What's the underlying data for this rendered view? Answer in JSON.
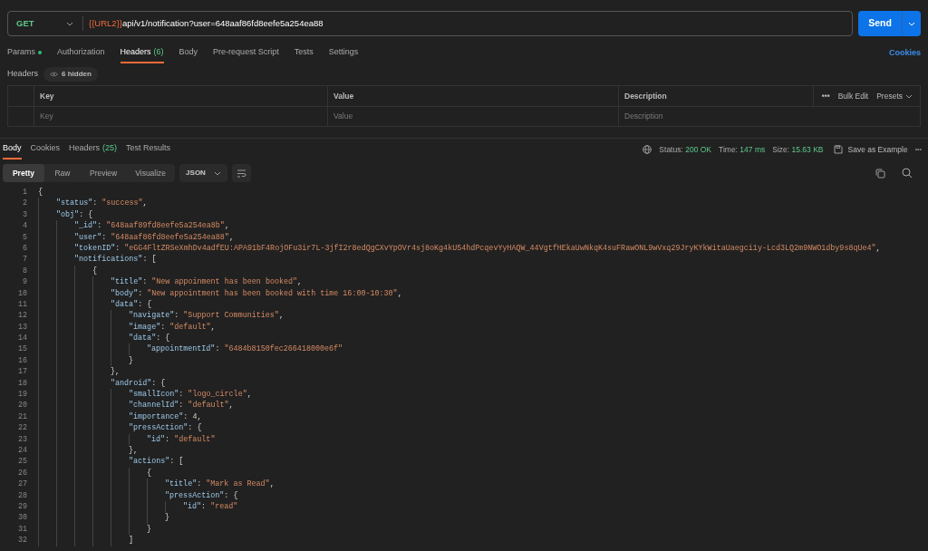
{
  "request": {
    "method": "GET",
    "url_variable": "{{URL2}}",
    "url_path": "api/v1/notification?user=648aaf86fd8eefe5a254ea88",
    "send": "Send"
  },
  "request_tabs": [
    {
      "label": "Params",
      "has_values": true,
      "selected": false
    },
    {
      "label": "Authorization",
      "selected": false
    },
    {
      "label": "Headers",
      "count": "(6)",
      "selected": true
    },
    {
      "label": "Body",
      "selected": false
    },
    {
      "label": "Pre-request Script",
      "selected": false
    },
    {
      "label": "Tests",
      "selected": false
    },
    {
      "label": "Settings",
      "selected": false
    }
  ],
  "cookies_link": "Cookies",
  "headers": {
    "title": "Headers",
    "hidden": "6 hidden",
    "columns": [
      "Key",
      "Value",
      "Description"
    ],
    "more": "•••",
    "bulk_edit": "Bulk Edit",
    "presets": "Presets",
    "placeholders": [
      "Key",
      "Value",
      "Description"
    ]
  },
  "response_tabs": [
    {
      "label": "Body",
      "selected": true
    },
    {
      "label": "Cookies",
      "selected": false
    },
    {
      "label": "Headers",
      "count": "(25)",
      "selected": false
    },
    {
      "label": "Test Results",
      "selected": false
    }
  ],
  "response_status": {
    "status_label": "Status:",
    "status": "200 OK",
    "time_label": "Time:",
    "time": "147 ms",
    "size_label": "Size:",
    "size": "15.63 KB",
    "save": "Save as Example",
    "more": "•••"
  },
  "view_modes": [
    {
      "label": "Pretty",
      "selected": true
    },
    {
      "label": "Raw",
      "selected": false
    },
    {
      "label": "Preview",
      "selected": false
    },
    {
      "label": "Visualize",
      "selected": false
    }
  ],
  "format": "JSON",
  "code_lines": [
    {
      "number": "1",
      "tokens": [
        {
          "kind": "punct",
          "text": "{"
        }
      ],
      "children": [
        {
          "number": "2",
          "tokens": [
            {
              "kind": "key",
              "text": "\"status\""
            },
            {
              "kind": "punct",
              "text": ": "
            },
            {
              "kind": "string",
              "text": "\"success\""
            },
            {
              "kind": "punct",
              "text": ","
            }
          ]
        },
        {
          "number": "3",
          "tokens": [
            {
              "kind": "key",
              "text": "\"obj\""
            },
            {
              "kind": "punct",
              "text": ": {"
            }
          ],
          "children": [
            {
              "number": "4",
              "tokens": [
                {
                  "kind": "key",
                  "text": "\"_id\""
                },
                {
                  "kind": "punct",
                  "text": ": "
                },
                {
                  "kind": "string",
                  "text": "\"648aaf89fd8eefe5a254ea8b\""
                },
                {
                  "kind": "punct",
                  "text": ","
                }
              ]
            },
            {
              "number": "5",
              "tokens": [
                {
                  "kind": "key",
                  "text": "\"user\""
                },
                {
                  "kind": "punct",
                  "text": ": "
                },
                {
                  "kind": "string",
                  "text": "\"648aaf86fd8eefe5a254ea88\""
                },
                {
                  "kind": "punct",
                  "text": ","
                }
              ]
            },
            {
              "number": "6",
              "tokens": [
                {
                  "kind": "key",
                  "text": "\"tokenID\""
                },
                {
                  "kind": "punct",
                  "text": ": "
                },
                {
                  "kind": "string",
                  "text": "\"eGG4FltZRSeXmhDv4adfEU:APA91bF4RojOFu3ir7L-3jfI2r8edQgCXvYpOVr4sj8oKg4kU54hdPcqevYyHAQW_44VgtfHEkaUwNkqK4suFRawONL9wVxq29JryKYkWitaUaegci1y-Lcd3LQ2m9NWO1dby9s8qUe4\""
                },
                {
                  "kind": "punct",
                  "text": ","
                }
              ]
            },
            {
              "number": "7",
              "tokens": [
                {
                  "kind": "key",
                  "text": "\"notifications\""
                },
                {
                  "kind": "punct",
                  "text": ": ["
                }
              ],
              "children": [
                {
                  "number": "8",
                  "tokens": [
                    {
                      "kind": "punct",
                      "text": "{"
                    }
                  ],
                  "children": [
                    {
                      "number": "9",
                      "tokens": [
                        {
                          "kind": "key",
                          "text": "\"title\""
                        },
                        {
                          "kind": "punct",
                          "text": ": "
                        },
                        {
                          "kind": "string",
                          "text": "\"New appoinment has been booked\""
                        },
                        {
                          "kind": "punct",
                          "text": ","
                        }
                      ]
                    },
                    {
                      "number": "10",
                      "tokens": [
                        {
                          "kind": "key",
                          "text": "\"body\""
                        },
                        {
                          "kind": "punct",
                          "text": ": "
                        },
                        {
                          "kind": "string",
                          "text": "\"New appointment has been booked with time 16:00-10:30\""
                        },
                        {
                          "kind": "punct",
                          "text": ","
                        }
                      ]
                    },
                    {
                      "number": "11",
                      "tokens": [
                        {
                          "kind": "key",
                          "text": "\"data\""
                        },
                        {
                          "kind": "punct",
                          "text": ": {"
                        }
                      ],
                      "children": [
                        {
                          "number": "12",
                          "tokens": [
                            {
                              "kind": "key",
                              "text": "\"navigate\""
                            },
                            {
                              "kind": "punct",
                              "text": ": "
                            },
                            {
                              "kind": "string",
                              "text": "\"Support Communities\""
                            },
                            {
                              "kind": "punct",
                              "text": ","
                            }
                          ]
                        },
                        {
                          "number": "13",
                          "tokens": [
                            {
                              "kind": "key",
                              "text": "\"image\""
                            },
                            {
                              "kind": "punct",
                              "text": ": "
                            },
                            {
                              "kind": "string",
                              "text": "\"default\""
                            },
                            {
                              "kind": "punct",
                              "text": ","
                            }
                          ]
                        },
                        {
                          "number": "14",
                          "tokens": [
                            {
                              "kind": "key",
                              "text": "\"data\""
                            },
                            {
                              "kind": "punct",
                              "text": ": {"
                            }
                          ],
                          "children": [
                            {
                              "number": "15",
                              "tokens": [
                                {
                                  "kind": "key",
                                  "text": "\"appointmentId\""
                                },
                                {
                                  "kind": "punct",
                                  "text": ": "
                                },
                                {
                                  "kind": "string",
                                  "text": "\"6484b8150fec266418000e6f\""
                                }
                              ]
                            }
                          ]
                        },
                        {
                          "number": "16",
                          "tokens": [
                            {
                              "kind": "punct",
                              "text": "}"
                            }
                          ]
                        }
                      ]
                    },
                    {
                      "number": "17",
                      "tokens": [
                        {
                          "kind": "punct",
                          "text": "},"
                        }
                      ]
                    },
                    {
                      "number": "18",
                      "tokens": [
                        {
                          "kind": "key",
                          "text": "\"android\""
                        },
                        {
                          "kind": "punct",
                          "text": ": {"
                        }
                      ],
                      "children": [
                        {
                          "number": "19",
                          "tokens": [
                            {
                              "kind": "key",
                              "text": "\"smallIcon\""
                            },
                            {
                              "kind": "punct",
                              "text": ": "
                            },
                            {
                              "kind": "string",
                              "text": "\"logo_circle\""
                            },
                            {
                              "kind": "punct",
                              "text": ","
                            }
                          ]
                        },
                        {
                          "number": "20",
                          "tokens": [
                            {
                              "kind": "key",
                              "text": "\"channelId\""
                            },
                            {
                              "kind": "punct",
                              "text": ": "
                            },
                            {
                              "kind": "string",
                              "text": "\"default\""
                            },
                            {
                              "kind": "punct",
                              "text": ","
                            }
                          ]
                        },
                        {
                          "number": "21",
                          "tokens": [
                            {
                              "kind": "key",
                              "text": "\"importance\""
                            },
                            {
                              "kind": "punct",
                              "text": ": "
                            },
                            {
                              "kind": "number",
                              "text": "4"
                            },
                            {
                              "kind": "punct",
                              "text": ","
                            }
                          ]
                        },
                        {
                          "number": "22",
                          "tokens": [
                            {
                              "kind": "key",
                              "text": "\"pressAction\""
                            },
                            {
                              "kind": "punct",
                              "text": ": {"
                            }
                          ],
                          "children": [
                            {
                              "number": "23",
                              "tokens": [
                                {
                                  "kind": "key",
                                  "text": "\"id\""
                                },
                                {
                                  "kind": "punct",
                                  "text": ": "
                                },
                                {
                                  "kind": "string",
                                  "text": "\"default\""
                                }
                              ]
                            }
                          ]
                        },
                        {
                          "number": "24",
                          "tokens": [
                            {
                              "kind": "punct",
                              "text": "},"
                            }
                          ]
                        },
                        {
                          "number": "25",
                          "tokens": [
                            {
                              "kind": "key",
                              "text": "\"actions\""
                            },
                            {
                              "kind": "punct",
                              "text": ": ["
                            }
                          ],
                          "children": [
                            {
                              "number": "26",
                              "tokens": [
                                {
                                  "kind": "punct",
                                  "text": "{"
                                }
                              ],
                              "children": [
                                {
                                  "number": "27",
                                  "tokens": [
                                    {
                                      "kind": "key",
                                      "text": "\"title\""
                                    },
                                    {
                                      "kind": "punct",
                                      "text": ": "
                                    },
                                    {
                                      "kind": "string",
                                      "text": "\"Mark as Read\""
                                    },
                                    {
                                      "kind": "punct",
                                      "text": ","
                                    }
                                  ]
                                },
                                {
                                  "number": "28",
                                  "tokens": [
                                    {
                                      "kind": "key",
                                      "text": "\"pressAction\""
                                    },
                                    {
                                      "kind": "punct",
                                      "text": ": {"
                                    }
                                  ],
                                  "children": [
                                    {
                                      "number": "29",
                                      "tokens": [
                                        {
                                          "kind": "key",
                                          "text": "\"id\""
                                        },
                                        {
                                          "kind": "punct",
                                          "text": ": "
                                        },
                                        {
                                          "kind": "string",
                                          "text": "\"read\""
                                        }
                                      ]
                                    }
                                  ]
                                },
                                {
                                  "number": "30",
                                  "tokens": [
                                    {
                                      "kind": "punct",
                                      "text": "}"
                                    }
                                  ]
                                }
                              ]
                            },
                            {
                              "number": "31",
                              "tokens": [
                                {
                                  "kind": "punct",
                                  "text": "}"
                                }
                              ]
                            }
                          ]
                        },
                        {
                          "number": "32",
                          "tokens": [
                            {
                              "kind": "punct",
                              "text": "]"
                            }
                          ]
                        }
                      ]
                    }
                  ]
                }
              ]
            }
          ]
        }
      ]
    }
  ]
}
